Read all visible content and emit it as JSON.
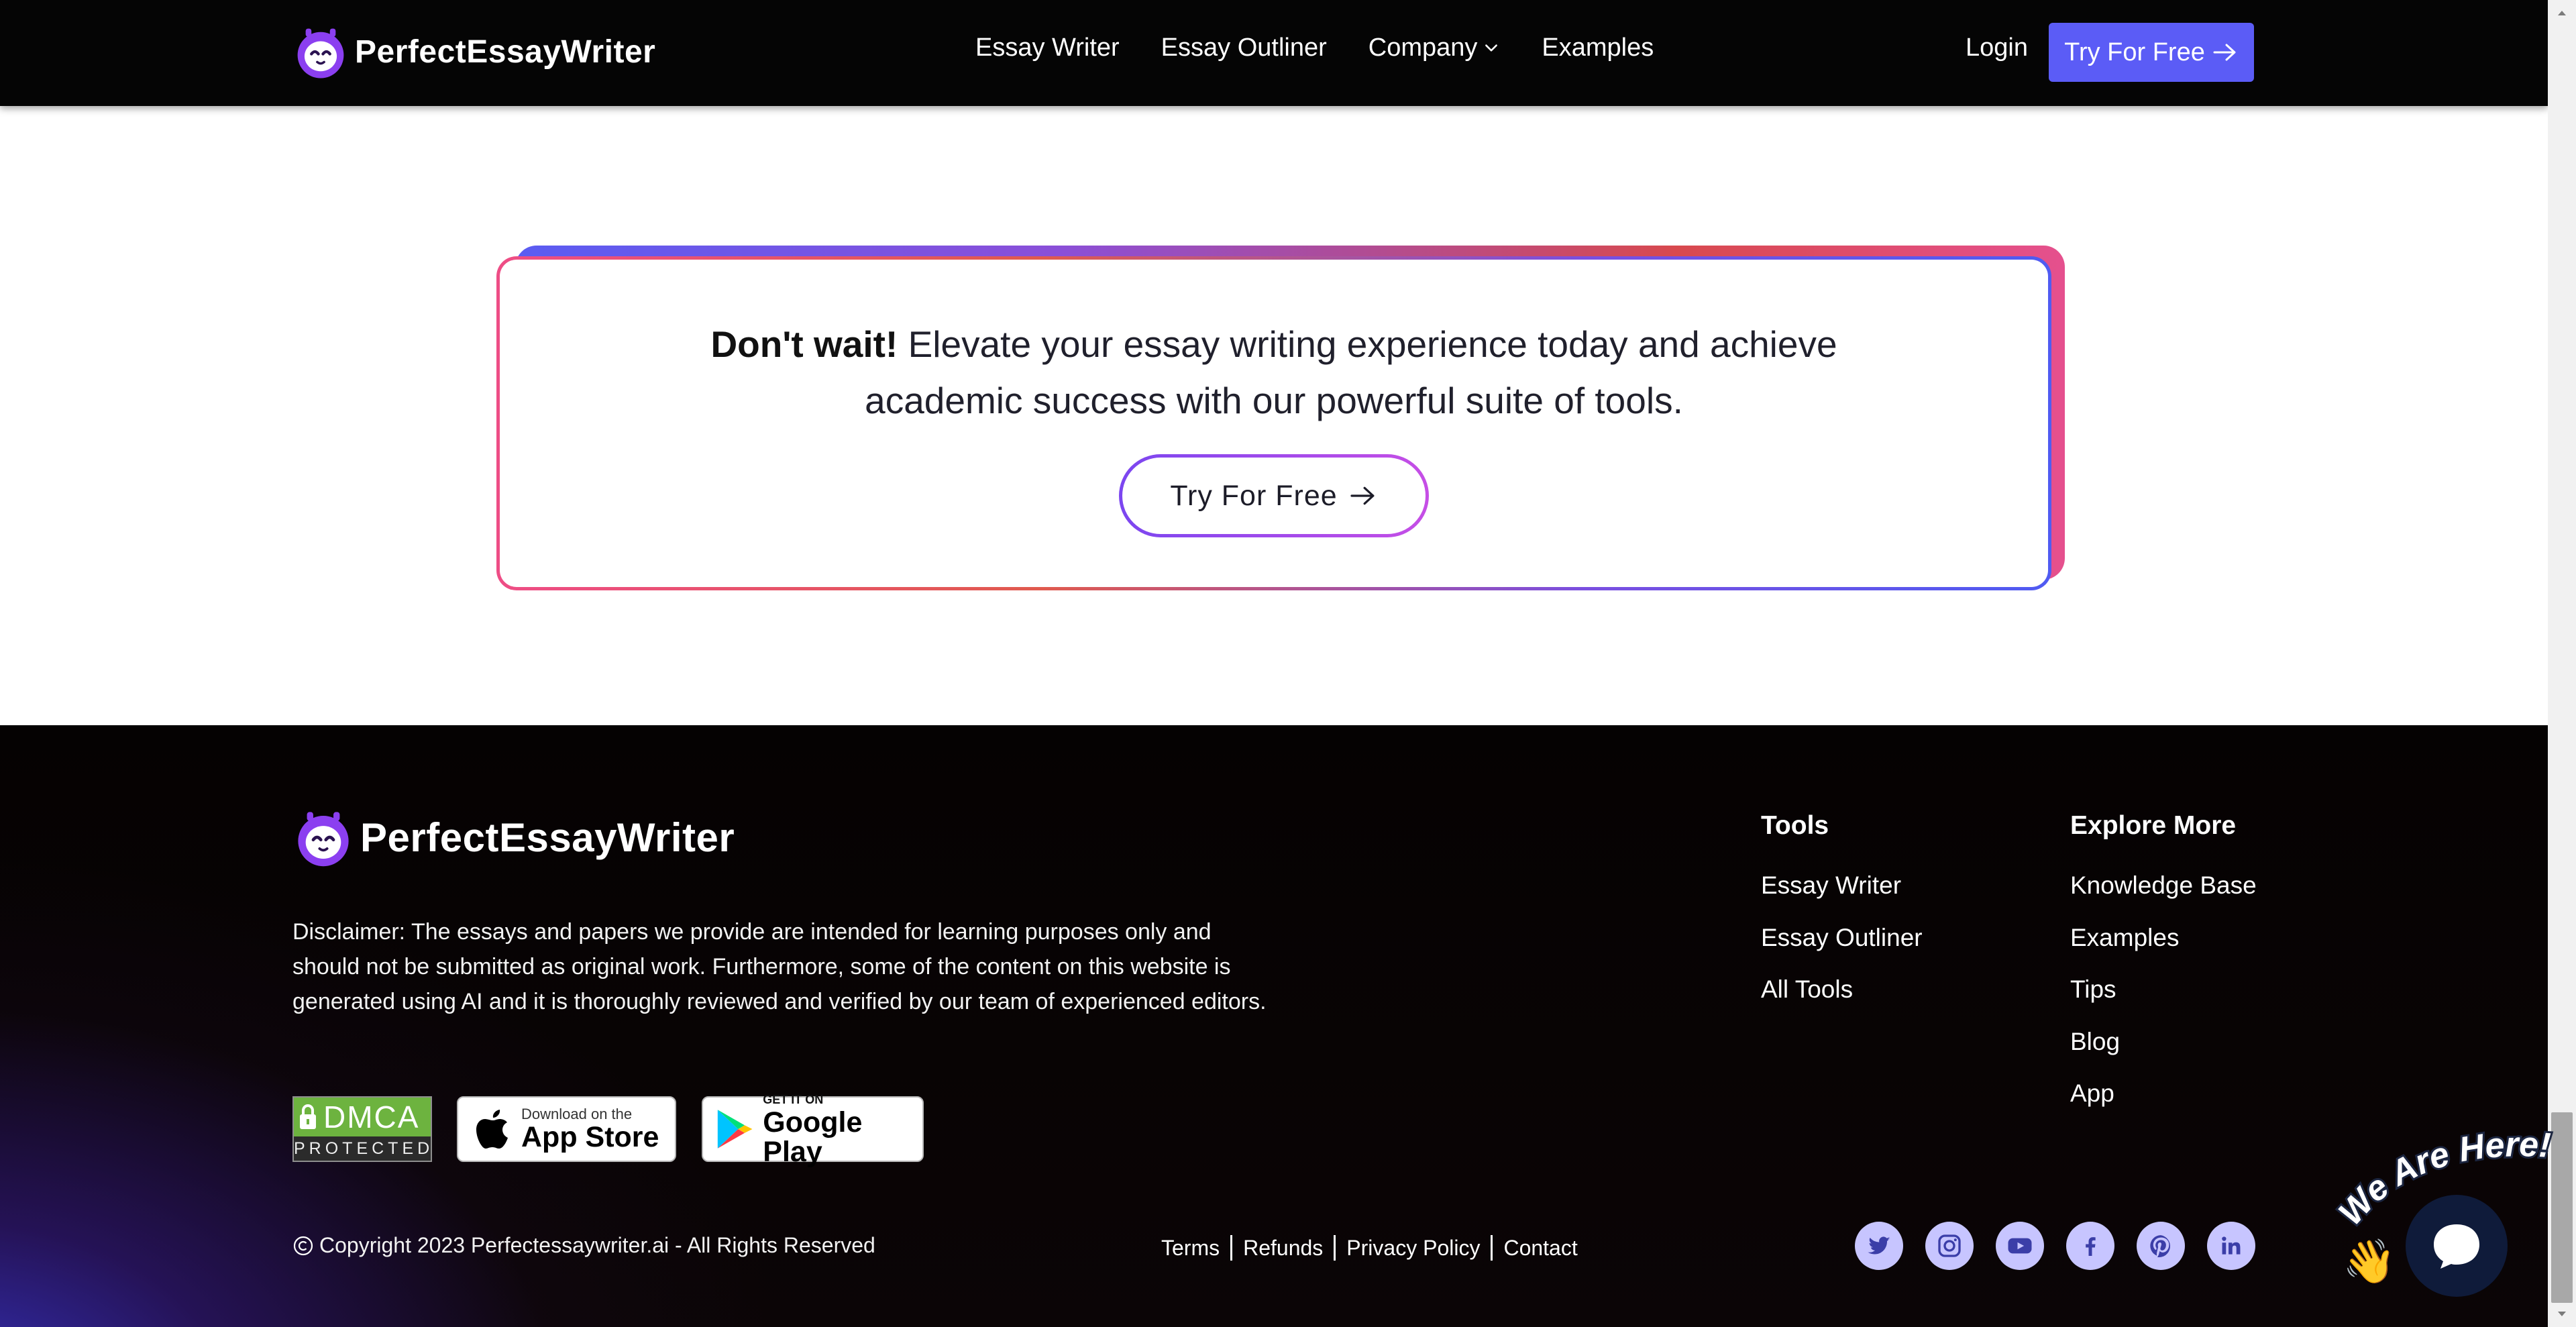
{
  "header": {
    "brand": "PerfectEssayWriter",
    "nav": [
      {
        "label": "Essay Writer"
      },
      {
        "label": "Essay Outliner"
      },
      {
        "label": "Company"
      },
      {
        "label": "Examples"
      }
    ],
    "login_label": "Login",
    "cta_label": "Try For Free"
  },
  "cta": {
    "bold_text": "Don't wait!",
    "line1": "Elevate your essay writing experience today and achieve",
    "line2": "academic success with our powerful suite of tools.",
    "button_label": "Try For Free"
  },
  "footer": {
    "brand": "PerfectEssayWriter",
    "disclaimer": "Disclaimer: The essays and papers we provide are intended for learning purposes only and should not be submitted as original work. Furthermore, some of the content on this website is generated using AI and it is thoroughly reviewed and verified by our team of experienced editors.",
    "badges": {
      "dmca_word": "DMCA",
      "dmca_sub": "PROTECTED",
      "appstore_small": "Download on the",
      "appstore_big": "App Store",
      "play_small": "GET IT ON",
      "play_big": "Google Play"
    },
    "copyright": "Copyright 2023 Perfectessaywriter.ai - All Rights Reserved",
    "legal_links": [
      "Terms",
      "Refunds",
      "Privacy Policy",
      "Contact"
    ],
    "tools": {
      "title": "Tools",
      "links": [
        "Essay Writer",
        "Essay Outliner",
        "All Tools"
      ]
    },
    "explore": {
      "title": "Explore More",
      "links": [
        "Knowledge Base",
        "Examples",
        "Tips",
        "Blog",
        "App"
      ]
    },
    "social_icons": [
      "twitter-icon",
      "instagram-icon",
      "youtube-icon",
      "facebook-icon",
      "pinterest-icon",
      "linkedin-icon"
    ]
  },
  "chat": {
    "label": "We Are Here!"
  },
  "colors": {
    "accent": "#5b5cf6",
    "social_bg": "#c7c5ff",
    "social_fg": "#3b3ea8",
    "footer_bg": "#050202",
    "chat_bubble": "#0f1b3a"
  }
}
